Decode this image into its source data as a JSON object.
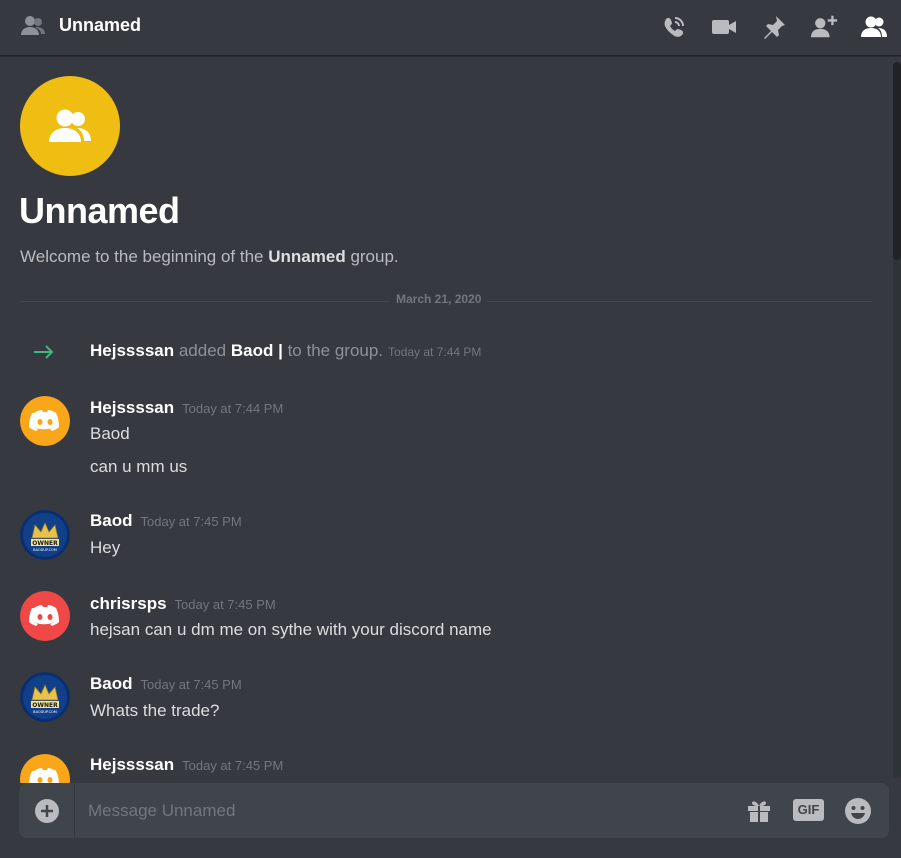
{
  "header": {
    "title": "Unnamed",
    "icons": [
      "group-icon",
      "start-voice-call-icon",
      "start-video-call-icon",
      "pinned-messages-icon",
      "add-friends-to-dm-icon",
      "member-list-icon"
    ]
  },
  "intro": {
    "title": "Unnamed",
    "desc_prefix": "Welcome to the beginning of the ",
    "desc_name": "Unnamed",
    "desc_suffix": " group.",
    "avatar_color": "#f0bd12"
  },
  "divider": {
    "date": "March 21, 2020"
  },
  "system_message": {
    "actor": "Hejssssan",
    "verb": " added ",
    "target": "Baod |",
    "rest": " to the group.",
    "timestamp": "Today at 7:44 PM",
    "arrow_color": "#43b581"
  },
  "messages": [
    {
      "author": "Hejssssan",
      "timestamp": "Today at 7:44 PM",
      "lines": [
        "Baod",
        "can u mm us"
      ],
      "avatar": "discord-orange"
    },
    {
      "author": "Baod",
      "timestamp": "Today at 7:45 PM",
      "lines": [
        "Hey"
      ],
      "avatar": "owner-crown"
    },
    {
      "author": "chrisrsps",
      "timestamp": "Today at 7:45 PM",
      "lines": [
        "hejsan can u dm me on sythe with your discord name"
      ],
      "avatar": "discord-red"
    },
    {
      "author": "Baod",
      "timestamp": "Today at 7:45 PM",
      "lines": [
        "Whats the trade?"
      ],
      "avatar": "owner-crown"
    },
    {
      "author": "Hejssssan",
      "timestamp": "Today at 7:45 PM",
      "lines": [],
      "avatar": "discord-orange"
    }
  ],
  "avatar_text": {
    "line1": "OWNER",
    "line2": "BAODUP.COM"
  },
  "composer": {
    "placeholder": "Message Unnamed",
    "value": "",
    "gif_label": "GIF"
  },
  "colors": {
    "background": "#36393f",
    "composer": "#40444b",
    "discord_orange": "#faa61a",
    "discord_red": "#f04747",
    "icon": "#b9bbbe"
  }
}
